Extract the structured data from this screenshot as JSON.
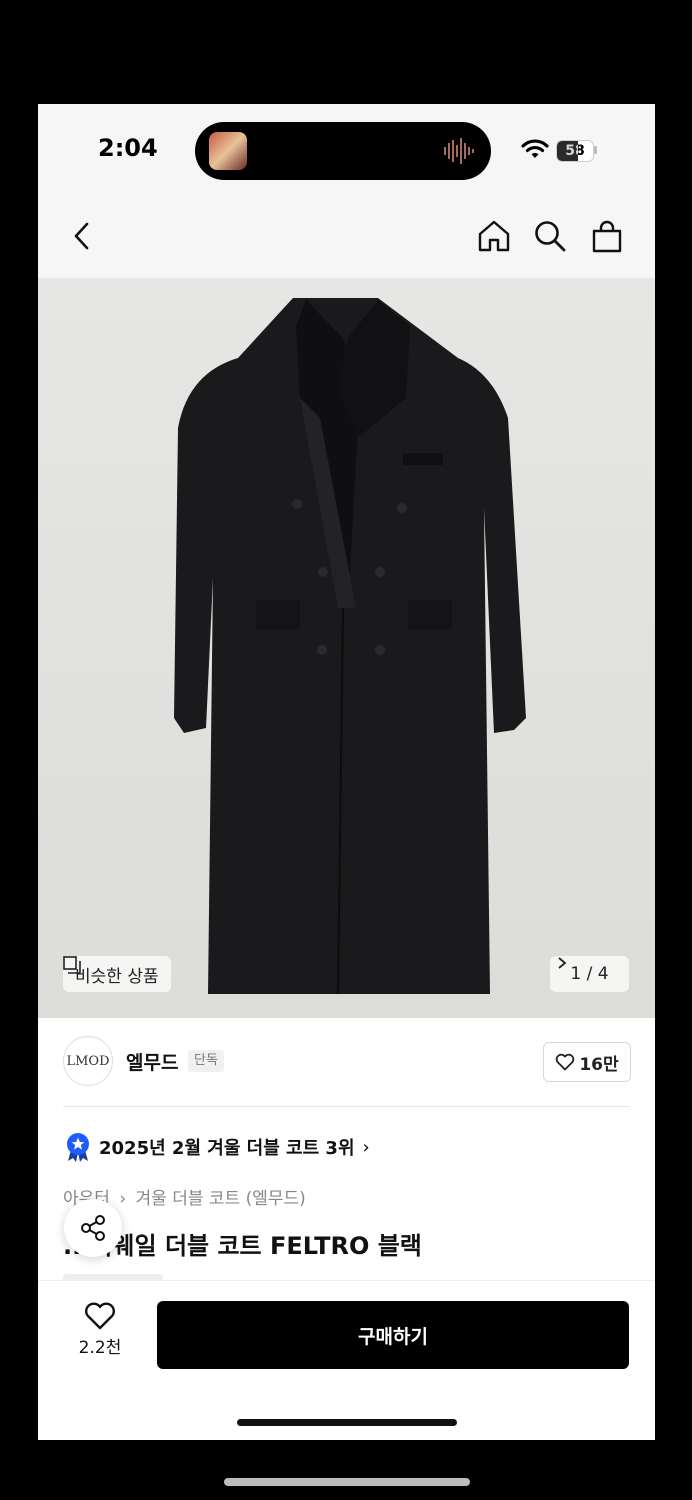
{
  "status_bar": {
    "time": "2:04",
    "battery": "58",
    "battery_level": 0.58
  },
  "nav": {
    "icons": [
      "back-arrow-icon",
      "home-icon",
      "search-icon",
      "shopping-bag-icon"
    ]
  },
  "hero": {
    "similar_label": "비슷한 상품",
    "pager": "1 / 4"
  },
  "brand": {
    "logo_text": "LMOD",
    "name": "엘무드",
    "badge": "단독",
    "likes": "16만"
  },
  "ranking": {
    "text": "2025년 2월 겨울 더블 코트 3위",
    "chevron": "›"
  },
  "breadcrumb": {
    "category": "아우터",
    "separator": "›",
    "sub": "겨울 더블 코트 (엘무드)"
  },
  "product": {
    "title": "...이웨일 더블 코트 FELTRO 블랙"
  },
  "bottom": {
    "wish_count": "2.2천",
    "buy_label": "구매하기"
  },
  "colors": {
    "accent": "#000000",
    "star_badge": "#1f5cff"
  }
}
